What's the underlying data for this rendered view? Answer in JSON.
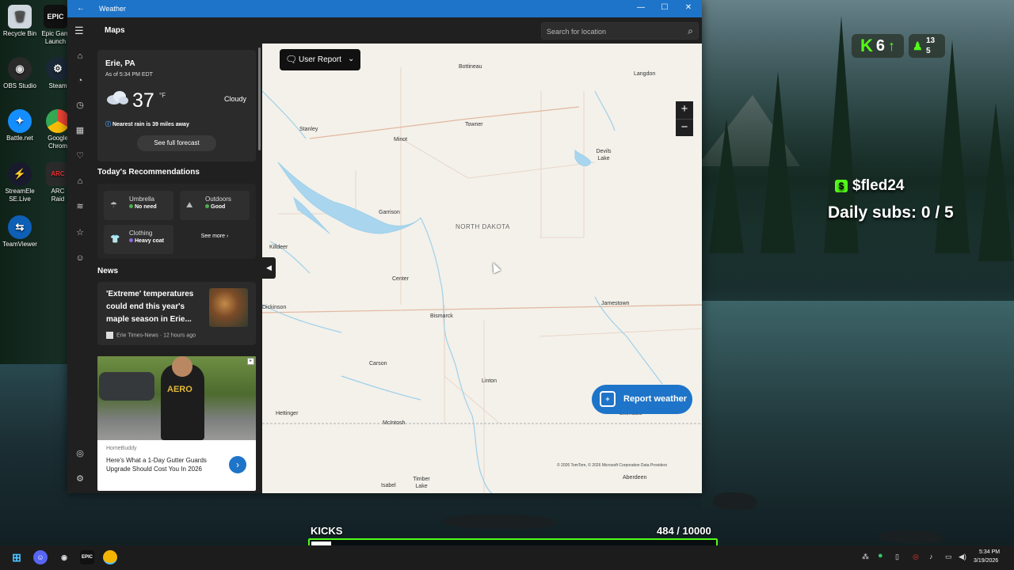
{
  "desktop": {
    "icons": [
      {
        "label": "Recycle Bin",
        "icon": "recycle-bin-icon"
      },
      {
        "label": "Epic Gam Launch",
        "icon": "epic-games-icon"
      },
      {
        "label": "OBS Studio",
        "icon": "obs-icon"
      },
      {
        "label": "Steam",
        "icon": "steam-icon"
      },
      {
        "label": "Battle.net",
        "icon": "battlenet-icon"
      },
      {
        "label": "Google Chrom",
        "icon": "chrome-icon"
      },
      {
        "label": "StreamEle SE.Live",
        "icon": "streamelements-icon"
      },
      {
        "label": "ARC Raid",
        "icon": "arc-raiders-icon"
      },
      {
        "label": "TeamViewer",
        "icon": "teamviewer-icon"
      }
    ]
  },
  "overlay": {
    "kick_badge": {
      "letter": "K",
      "value": "6",
      "arrow": "↑"
    },
    "viewers": {
      "top": "13",
      "bottom": "5"
    },
    "sub_name": "$fled24",
    "daily_subs": "Daily subs:  0 / 5",
    "kicks_label": "KICKS",
    "kicks_count": "484  / 10000",
    "kicks_progress": 0.0484,
    "accent_color": "#53fc18"
  },
  "window": {
    "title": "Weather",
    "back": "←",
    "controls": {
      "minimize": "—",
      "maximize": "☐",
      "close": "✕"
    }
  },
  "header": {
    "menu_icon": "☰",
    "page_title": "Maps",
    "search_placeholder": "Search for location",
    "search_icon": "⌕"
  },
  "rail": [
    "home-icon",
    "radar-icon",
    "history-icon",
    "calendar-icon",
    "favorites-icon",
    "life-icon",
    "trends-icon",
    "star-icon",
    "face-icon",
    "account-icon",
    "settings-icon"
  ],
  "location": {
    "name": "Erie, PA",
    "as_of": "As of 5:34 PM EDT",
    "temperature": "37",
    "unit": "°F",
    "condition": "Cloudy",
    "rain_note": "Nearest rain is 39 miles away",
    "forecast_button": "See full forecast"
  },
  "recommendations": {
    "title": "Today's Recommendations",
    "items": [
      {
        "label": "Umbrella",
        "value": "No need",
        "dot": "#4caf50",
        "icon": "umbrella-icon"
      },
      {
        "label": "Outdoors",
        "value": "Good",
        "dot": "#4caf50",
        "icon": "outdoors-icon"
      },
      {
        "label": "Clothing",
        "value": "Heavy coat",
        "dot": "#8a6bd8",
        "icon": "clothing-icon"
      }
    ],
    "see_more": "See more"
  },
  "news": {
    "title": "News",
    "headline": "'Extreme' temperatures could end this year's maple season in Erie...",
    "source": "Erie Times-News · 12 hours ago"
  },
  "ad": {
    "brand": "HomeBuddy",
    "text": "Here's What a 1-Day Gutter Guards Upgrade Should Cost You In 2026",
    "image_text": "AERO"
  },
  "map": {
    "user_report": "User Report",
    "state": "NORTH DAKOTA",
    "cities": [
      {
        "name": "Bottineau"
      },
      {
        "name": "Langdon"
      },
      {
        "name": "Towner"
      },
      {
        "name": "Stanley"
      },
      {
        "name": "Minot"
      },
      {
        "name": "Devils Lake"
      },
      {
        "name": "Garrison"
      },
      {
        "name": "Killdeer"
      },
      {
        "name": "Center"
      },
      {
        "name": "Dickinson"
      },
      {
        "name": "Bismarck"
      },
      {
        "name": "Jamestown"
      },
      {
        "name": "Carson"
      },
      {
        "name": "Linton"
      },
      {
        "name": "Hettinger"
      },
      {
        "name": "McIntosh"
      },
      {
        "name": "Ellendale"
      },
      {
        "name": "Isabel"
      },
      {
        "name": "Timber Lake"
      },
      {
        "name": "Aberdeen"
      }
    ],
    "zoom_in": "+",
    "zoom_out": "−",
    "report_weather": "Report weather",
    "attribution": "© 2026 TomTom, © 2026 Microsoft Corporation  Data Providers"
  },
  "taskbar": {
    "time": "5:34 PM",
    "date": "3/19/2026"
  }
}
